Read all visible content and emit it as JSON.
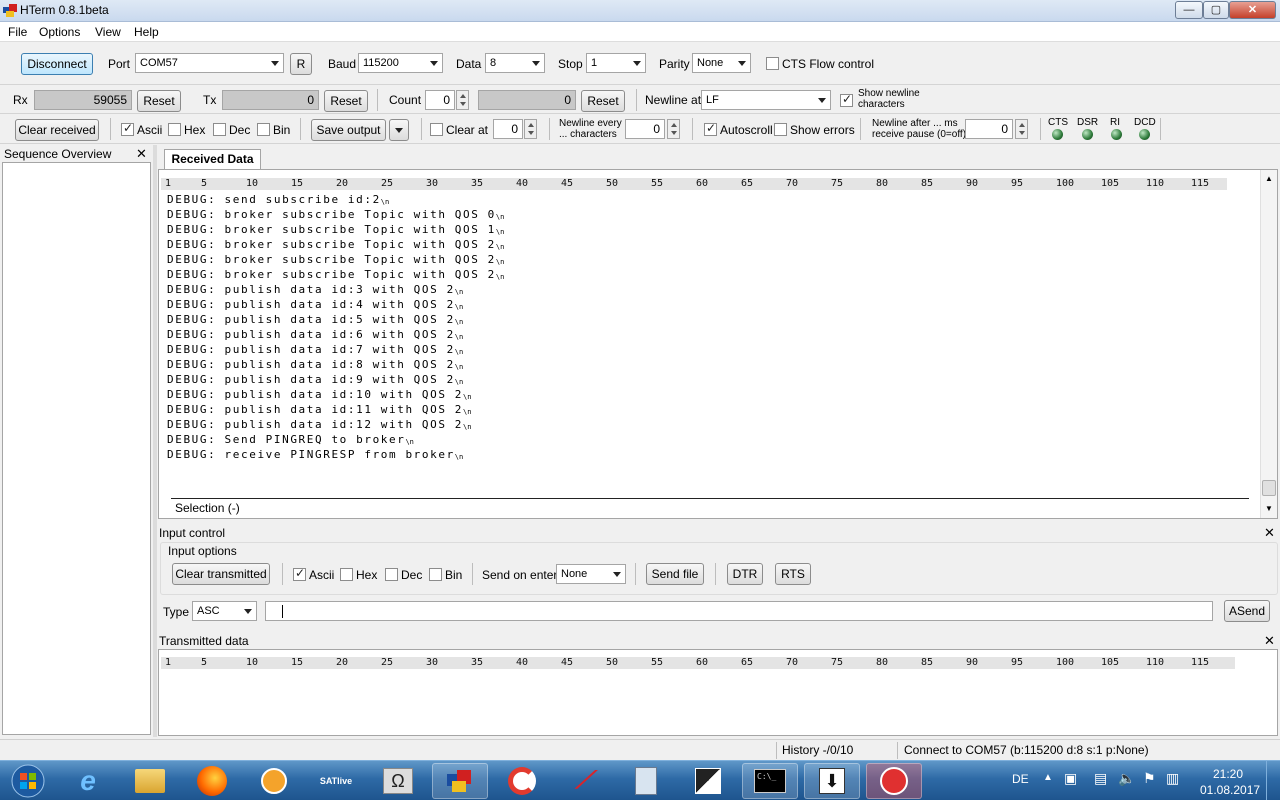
{
  "window": {
    "title": "HTerm 0.8.1beta",
    "btn_min": "—",
    "btn_max": "▢",
    "btn_close": "✕"
  },
  "menu": [
    "File",
    "Options",
    "View",
    "Help"
  ],
  "connection": {
    "disconnect_label": "Disconnect",
    "port_label": "Port",
    "port_value": "COM57",
    "refresh_label": "R",
    "baud_label": "Baud",
    "baud_value": "115200",
    "data_label": "Data",
    "data_value": "8",
    "stop_label": "Stop",
    "stop_value": "1",
    "parity_label": "Parity",
    "parity_value": "None",
    "cts_label": "CTS Flow control"
  },
  "counters": {
    "rx_label": "Rx",
    "rx_value": "59055",
    "rx_reset": "Reset",
    "tx_label": "Tx",
    "tx_value": "0",
    "tx_reset": "Reset",
    "count_label": "Count",
    "count_value": "0",
    "count_field": "0",
    "count_reset": "Reset",
    "newline_at_label": "Newline at",
    "newline_at_value": "LF",
    "show_newline_label": "Show newline characters"
  },
  "display": {
    "clear_received": "Clear received",
    "ascii": "Ascii",
    "hex": "Hex",
    "dec": "Dec",
    "bin": "Bin",
    "save_output": "Save output",
    "clear_at_label": "Clear at",
    "clear_at_value": "0",
    "newline_every_label": "Newline every ... characters",
    "newline_every_value": "0",
    "autoscroll": "Autoscroll",
    "show_errors": "Show errors",
    "newline_after_label": "Newline after ... ms receive pause (0=off)",
    "newline_after_value": "0",
    "signals": [
      "CTS",
      "DSR",
      "RI",
      "DCD"
    ]
  },
  "sequence_overview": {
    "title": "Sequence Overview",
    "close": "✕"
  },
  "received": {
    "tab": "Received Data",
    "ruler": [
      "1",
      "5",
      "10",
      "15",
      "20",
      "25",
      "30",
      "35",
      "40",
      "45",
      "50",
      "55",
      "60",
      "65",
      "70",
      "75",
      "80",
      "85",
      "90",
      "95",
      "100",
      "105",
      "110",
      "115"
    ],
    "newline_symbol": "\\n",
    "lines": [
      "DEBUG: send subscribe id:2",
      "DEBUG: broker subscribe Topic with QOS 0",
      "DEBUG: broker subscribe Topic with QOS 1",
      "DEBUG: broker subscribe Topic with QOS 2",
      "DEBUG: broker subscribe Topic with QOS 2",
      "DEBUG: broker subscribe Topic with QOS 2",
      "DEBUG: publish data id:3 with QOS 2",
      "DEBUG: publish data id:4 with QOS 2",
      "DEBUG: publish data id:5 with QOS 2",
      "DEBUG: publish data id:6 with QOS 2",
      "DEBUG: publish data id:7 with QOS 2",
      "DEBUG: publish data id:8 with QOS 2",
      "DEBUG: publish data id:9 with QOS 2",
      "DEBUG: publish data id:10 with QOS 2",
      "DEBUG: publish data id:11 with QOS 2",
      "DEBUG: publish data id:12 with QOS 2",
      "DEBUG: Send PINGREQ to broker",
      "DEBUG: receive PINGRESP from broker"
    ],
    "selection": "Selection (-)"
  },
  "input_control": {
    "title": "Input control",
    "close": "✕",
    "options_label": "Input options",
    "clear_transmitted": "Clear transmitted",
    "ascii": "Ascii",
    "hex": "Hex",
    "dec": "Dec",
    "bin": "Bin",
    "send_on_enter_label": "Send on enter",
    "send_on_enter_value": "None",
    "send_file": "Send file",
    "dtr": "DTR",
    "rts": "RTS",
    "type_label": "Type",
    "type_value": "ASC",
    "input_value": "",
    "asend": "ASend"
  },
  "transmitted": {
    "title": "Transmitted data",
    "close": "✕",
    "ruler": [
      "1",
      "5",
      "10",
      "15",
      "20",
      "25",
      "30",
      "35",
      "40",
      "45",
      "50",
      "55",
      "60",
      "65",
      "70",
      "75",
      "80",
      "85",
      "90",
      "95",
      "100",
      "105",
      "110",
      "115"
    ]
  },
  "status": {
    "history": "History -/0/10",
    "connection": "Connect to COM57 (b:115200 d:8 s:1 p:None)"
  },
  "taskbar": {
    "lang": "DE",
    "time": "21:20",
    "date": "01.08.2017",
    "apps": [
      "start-orb",
      "internet-explorer",
      "file-explorer",
      "firefox",
      "media-player",
      "satlive",
      "character-map",
      "hterm-app",
      "ccleaner",
      "altium",
      "calculator",
      "app-tile",
      "command-prompt",
      "downloader",
      "hterm-red"
    ],
    "satlive_label": "SATlive",
    "cmd_label": "C:\\_"
  },
  "colors": {
    "accent": "#3c7fb1",
    "taskbar": "#2e6aa6",
    "led": "#2d7a3a"
  }
}
